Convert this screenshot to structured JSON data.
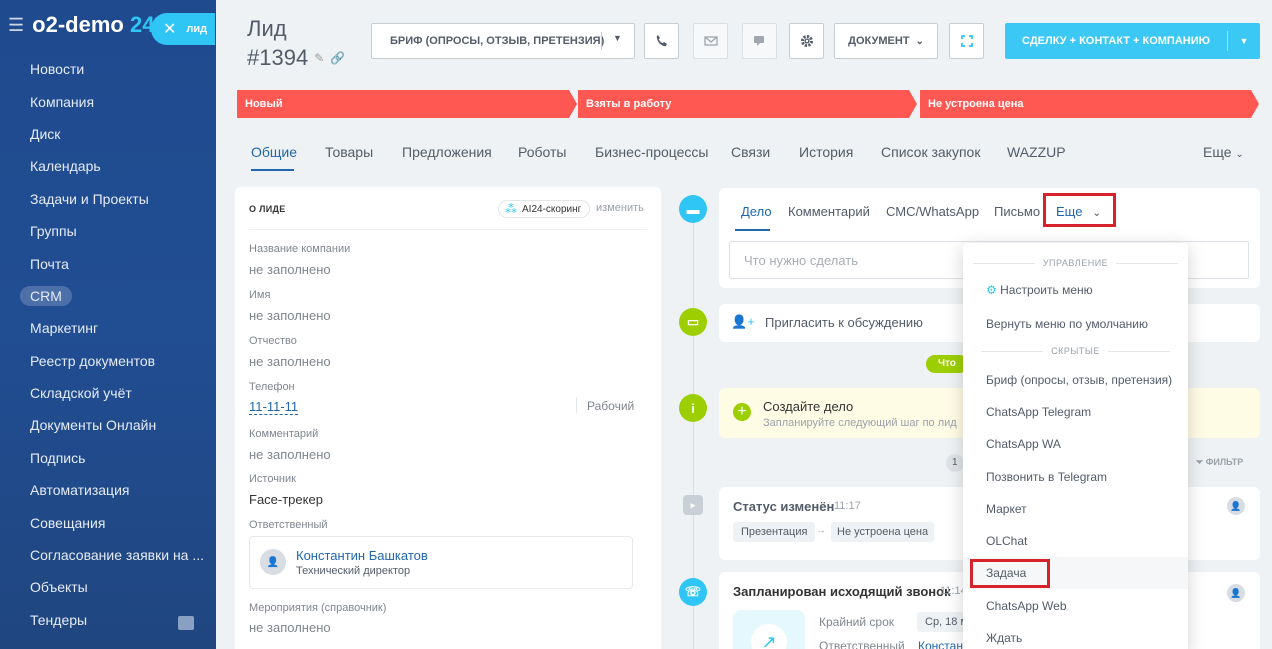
{
  "sidebar": {
    "brand_name": "o2-demo",
    "brand_num": "24",
    "close_label": "лид",
    "items": [
      "Новости",
      "Компания",
      "Диск",
      "Календарь",
      "Задачи и Проекты",
      "Группы",
      "Почта",
      "CRM",
      "Маркетинг",
      "Реестр документов",
      "Складской учёт",
      "Документы Онлайн",
      "Подпись",
      "Автоматизация",
      "Совещания",
      "Согласование заявки на ...",
      "Объекты",
      "Тендеры"
    ]
  },
  "header": {
    "title_line1": "Лид",
    "title_line2": "#1394",
    "brief_button": "БРИФ (ОПРОСЫ, ОТЗЫВ, ПРЕТЕНЗИЯ)",
    "document_button": "ДОКУМЕНТ",
    "deal_button": "СДЕЛКУ + КОНТАКТ + КОМПАНИЮ"
  },
  "stages": [
    "Новый",
    "Взяты в работу",
    "Не устроена цена"
  ],
  "tabs": [
    "Общие",
    "Товары",
    "Предложения",
    "Роботы",
    "Бизнес-процессы",
    "Связи",
    "История",
    "Список закупок",
    "WAZZUP"
  ],
  "tabs_more": "Еще",
  "about": {
    "title": "О ЛИДЕ",
    "scoring": "AI24-скоринг",
    "edit": "изменить",
    "fields": [
      {
        "label": "Название компании",
        "value": "не заполнено"
      },
      {
        "label": "Имя",
        "value": "не заполнено"
      },
      {
        "label": "Отчество",
        "value": "не заполнено"
      },
      {
        "label": "Телефон",
        "value": "11-11-11",
        "type": "Рабочий"
      },
      {
        "label": "Комментарий",
        "value": "не заполнено"
      },
      {
        "label": "Источник",
        "value": "Face-трекер"
      },
      {
        "label": "Ответственный"
      },
      {
        "label": "Мероприятия (справочник)",
        "value": "не заполнено"
      }
    ],
    "responsible_name": "Константин Башкатов",
    "responsible_role": "Технический директор"
  },
  "timeline": {
    "subtabs": [
      "Дело",
      "Комментарий",
      "СМС/WhatsApp",
      "Письмо"
    ],
    "more": "Еще",
    "input_placeholder": "Что нужно сделать",
    "invite": "Пригласить к обсуждению",
    "green_badge": "Что",
    "create_title": "Создайте дело",
    "create_sub": "Запланируйте следующий шаг по лид",
    "filter": "ФИЛЬТР",
    "date_chip": "1",
    "status_title": "Статус изменён",
    "status_time": "11:17",
    "status_from": "Презентация",
    "status_to": "Не устроена цена",
    "call_title": "Запланирован исходящий звонок",
    "call_time": "11:14",
    "deadline_label": "Крайний срок",
    "deadline_value": "Ср, 18 м",
    "resp_label": "Ответственный",
    "resp_value": "Констан"
  },
  "dropdown": {
    "section_manage": "УПРАВЛЕНИЕ",
    "configure": "Настроить меню",
    "reset": "Вернуть меню по умолчанию",
    "section_hidden": "СКРЫТЫЕ",
    "hidden_items": [
      "Бриф (опросы, отзыв, претензия)",
      "ChatsApp Telegram",
      "ChatsApp WA",
      "Позвонить в Telegram",
      "Маркет",
      "OLChat",
      "Задача",
      "ChatsApp Web",
      "Ждать"
    ]
  },
  "colors": {
    "accent": "#2fc6f6",
    "stage": "#ff5752",
    "highlight": "#d6232b",
    "sidebar": "#1f4a8e"
  }
}
